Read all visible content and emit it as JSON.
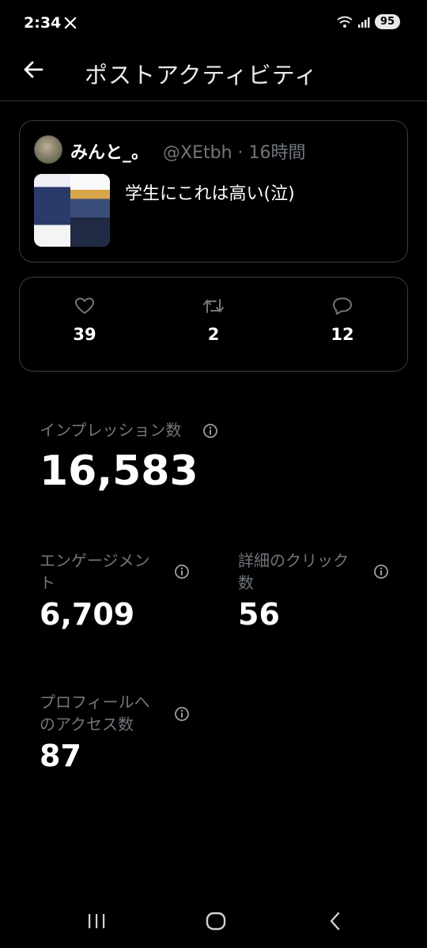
{
  "status_bar": {
    "time": "2:34",
    "battery": "95",
    "icons": [
      "x-logo-icon",
      "wifi-icon",
      "signal-icon"
    ]
  },
  "header": {
    "title": "ポストアクティビティ",
    "back_icon": "arrow-left-icon"
  },
  "post": {
    "display_name": "みんと_。",
    "handle_time": "@XEtbh · 16時間",
    "text": "学生にこれは高い(泣)"
  },
  "engagement": {
    "likes": "39",
    "reposts": "2",
    "replies": "12"
  },
  "metrics": {
    "impressions": {
      "label": "インプレッション数",
      "value": "16,583"
    },
    "engagements": {
      "label_line1": "エンゲージメン",
      "label_line2": "ト",
      "value": "6,709"
    },
    "detail_clicks": {
      "label_line1": "詳細のクリック",
      "label_line2": "数",
      "value": "56"
    },
    "profile_visits": {
      "label_line1": "プロフィールへ",
      "label_line2": "のアクセス数",
      "value": "87"
    }
  },
  "colors": {
    "background": "#000000",
    "text": "#e7e9ea",
    "muted": "#71767b",
    "border": "#3a3e41"
  }
}
